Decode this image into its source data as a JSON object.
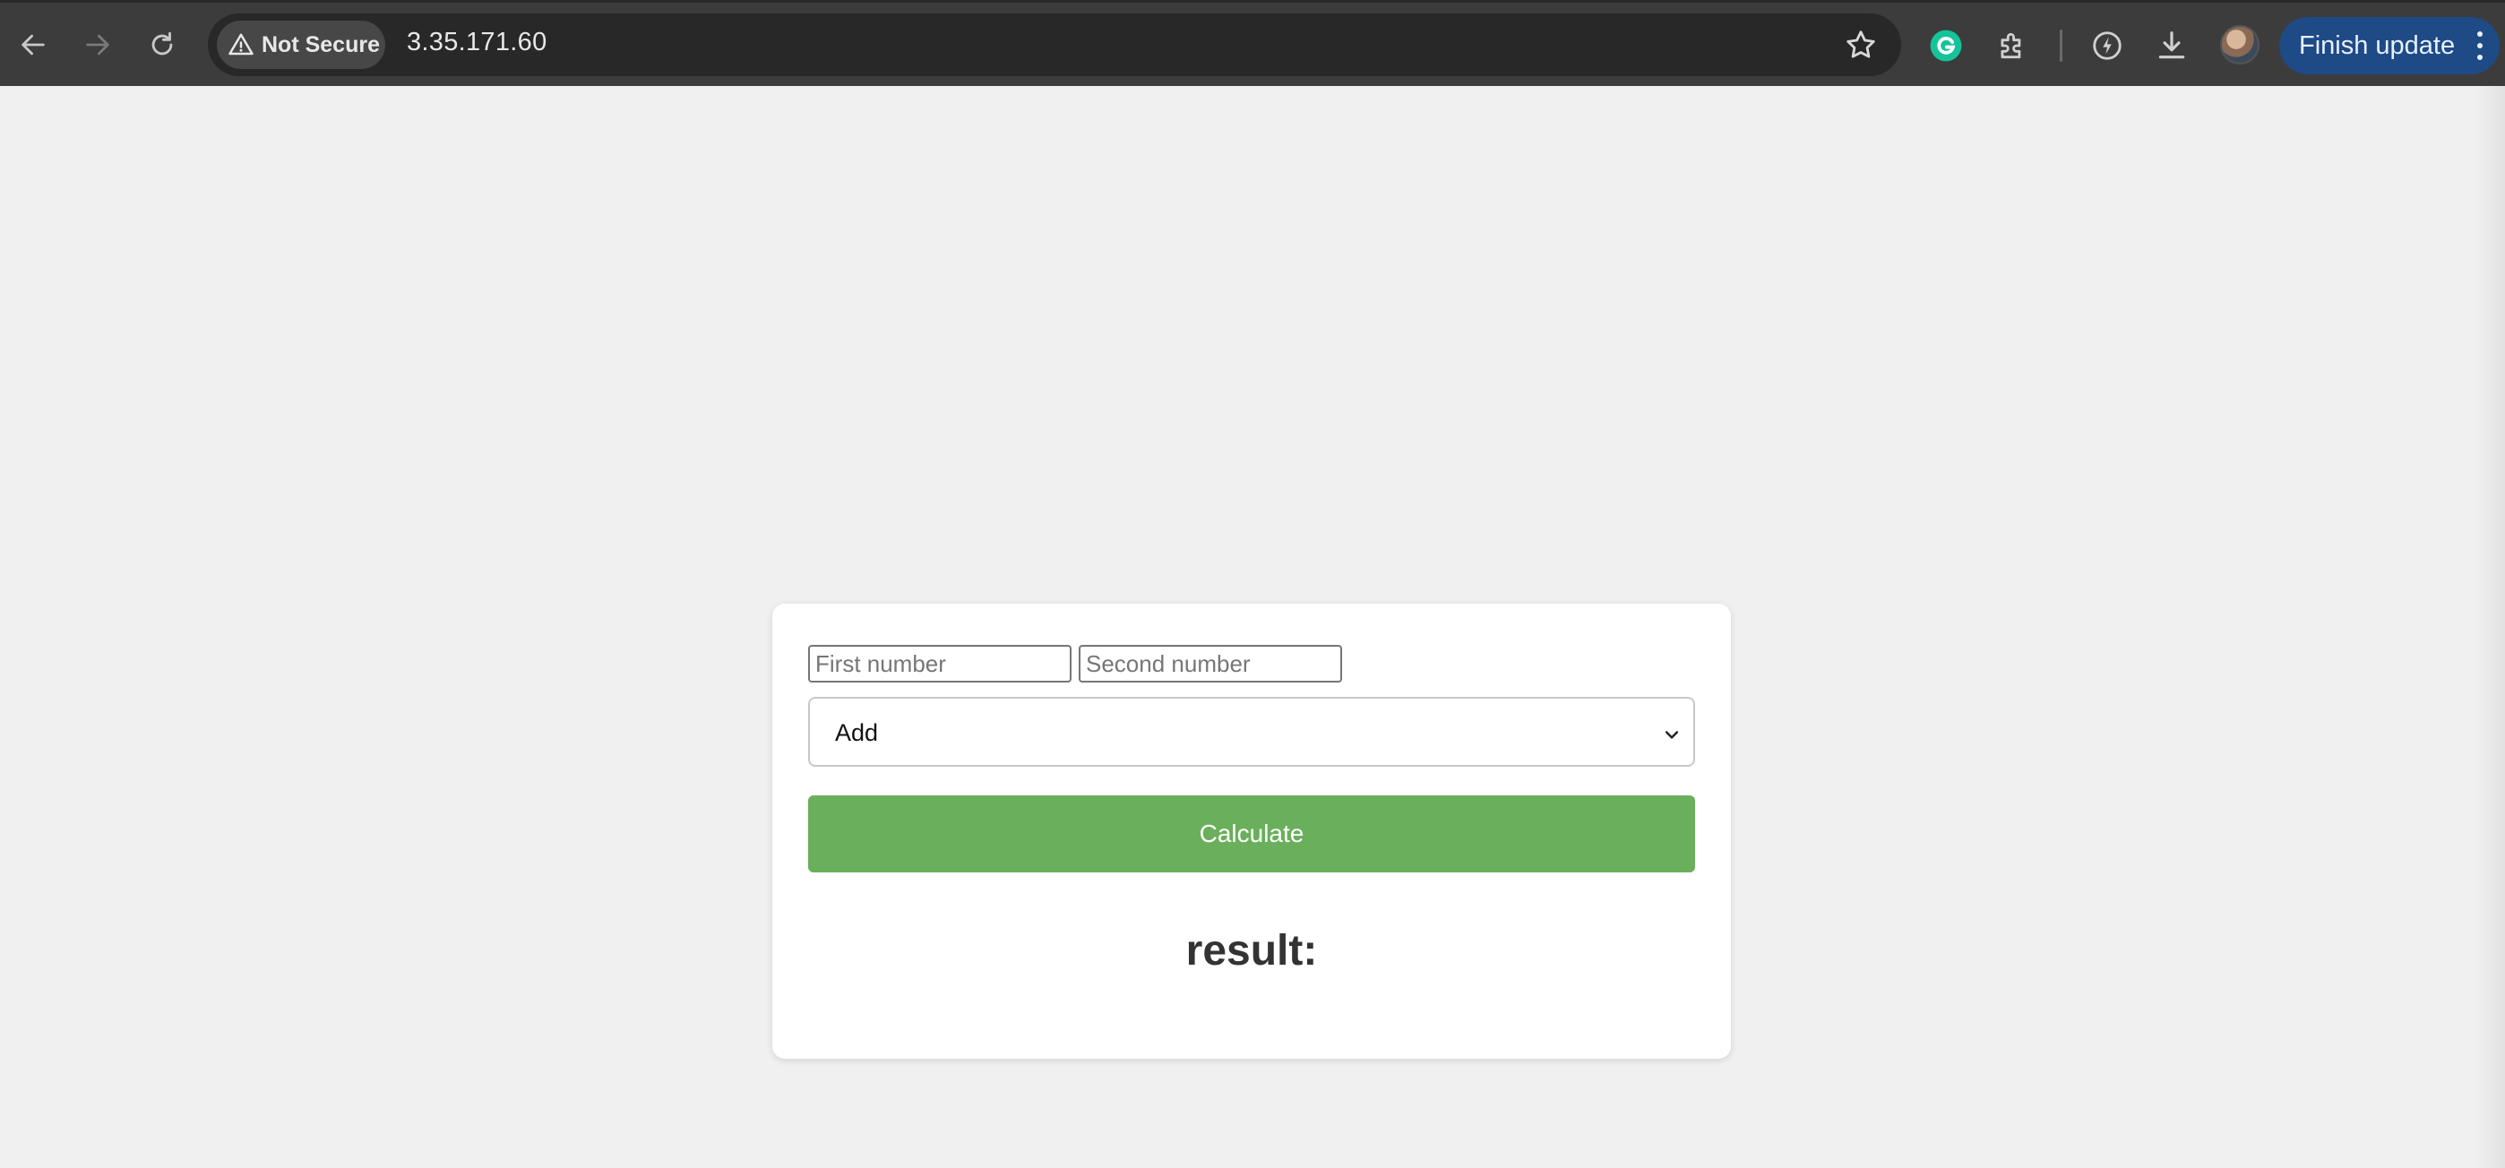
{
  "browser": {
    "security_label": "Not Secure",
    "url": "3.35.171.60",
    "finish_update_label": "Finish update",
    "icons": [
      "back-arrow-icon",
      "forward-arrow-icon",
      "reload-icon",
      "warning-icon",
      "star-icon",
      "grammarly-icon",
      "extensions-icon",
      "performance-icon",
      "download-icon",
      "profile-avatar",
      "more-menu-icon"
    ]
  },
  "form": {
    "first_placeholder": "First number",
    "second_placeholder": "Second number",
    "first_value": "",
    "second_value": "",
    "operation_selected": "Add",
    "calculate_label": "Calculate",
    "result_label": "result:"
  },
  "colors": {
    "page_bg": "#f0f0f0",
    "toolbar_bg": "#3c3c3c",
    "calculate_button": "#6aaf5c",
    "finish_update_bg": "#1e4a86"
  }
}
